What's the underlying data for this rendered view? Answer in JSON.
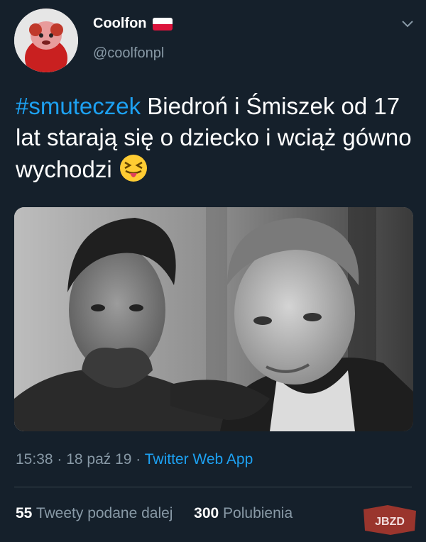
{
  "tweet": {
    "author_name": "Coolfon",
    "author_handle": "@coolfonpl",
    "hashtag": "#smuteczek",
    "text_rest": " Biedroń i Śmiszek od 17 lat starają się o dziecko i wciąż gówno wychodzi",
    "timestamp": "15:38 · 18 paź 19 · ",
    "source_app": "Twitter Web App",
    "retweet_count": "55",
    "retweet_label": "Tweety podane dalej",
    "like_count": "300",
    "like_label": "Polubienia"
  },
  "icons": {
    "flag": "poland-flag-icon",
    "emoji": "squinting-face-tongue-emoji",
    "menu": "chevron-down-icon"
  },
  "watermark": "JBZD",
  "colors": {
    "background": "#15202b",
    "accent": "#1da1f2",
    "secondary_text": "#8899a6"
  }
}
